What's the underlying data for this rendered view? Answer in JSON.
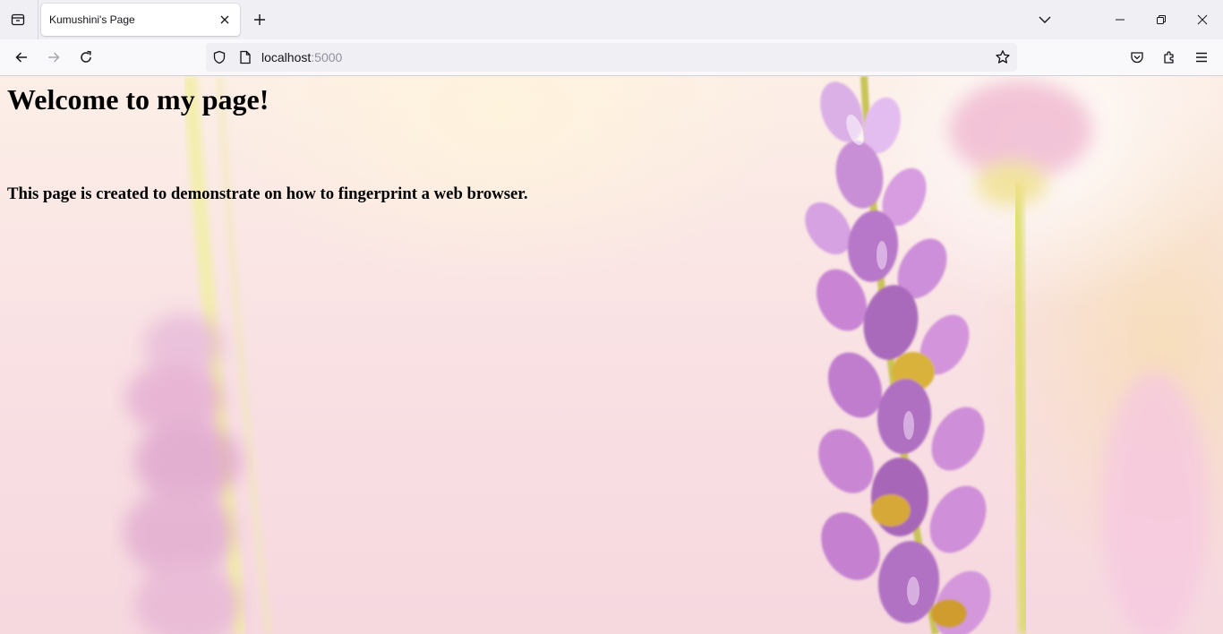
{
  "browser": {
    "tab": {
      "title": "Kumushini's Page"
    },
    "url": {
      "host": "localhost",
      "port": ":5000"
    },
    "toolbar_icons": [
      "back-icon",
      "forward-icon",
      "reload-icon",
      "star-icon",
      "pocket-icon",
      "extensions-icon",
      "menu-icon"
    ],
    "window_controls": [
      "minimize-icon",
      "restore-icon",
      "close-icon"
    ]
  },
  "page": {
    "heading": "Welcome to my page!",
    "subheading": "This page is created to demonstrate on how to fingerprint a web browser."
  },
  "colors": {
    "tabbar_bg": "#f0f0f4",
    "navbar_bg": "#f9f9fb",
    "text": "#000000",
    "lavender": "#c98fd6",
    "stem": "#d9dc6a"
  }
}
